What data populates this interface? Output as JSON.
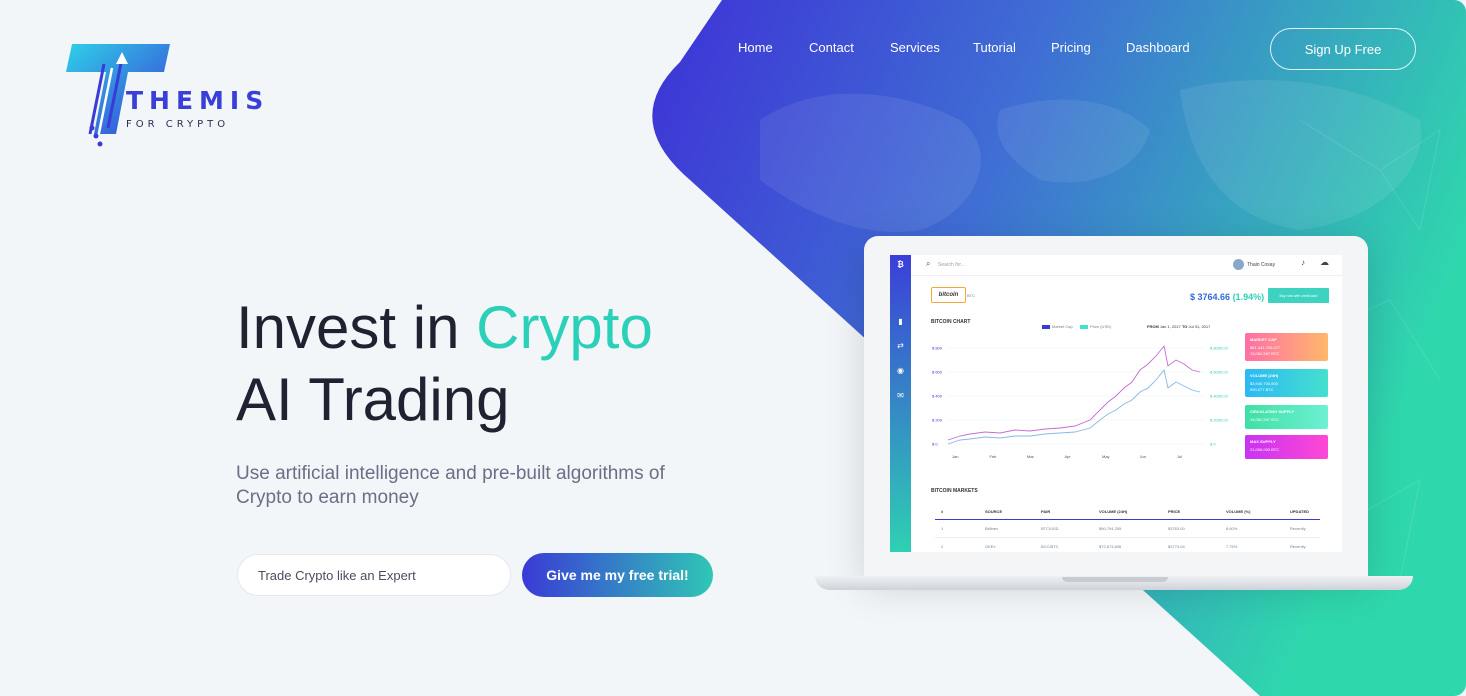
{
  "brand": {
    "name": "THEMIS",
    "tagline": "FOR CRYPTO"
  },
  "nav": {
    "items": [
      "Home",
      "Contact",
      "Services",
      "Tutorial",
      "Pricing",
      "Dashboard"
    ],
    "signup_label": "Sign Up Free"
  },
  "hero": {
    "title_line1_a": "Invest in ",
    "title_line1_b": "Crypto",
    "title_line2": "AI Trading",
    "lead": "Use artificial intelligence and pre-built algorithms of Crypto to earn money",
    "input_value": "Trade Crypto like an Expert",
    "cta_label": "Give me my free trial!"
  },
  "colors": {
    "accent": "#2bd0b8",
    "brand_blue": "#3a3ad6",
    "teal": "#2fd0b3"
  },
  "dashboard": {
    "search_placeholder": "Search for...",
    "user_name": "Thain Cosay",
    "coin_label": "bitcoin",
    "coin_ticker": "BTC",
    "price": "$ 3764.66",
    "change": "(1.94%)",
    "buy_button": "Buy now with credit card",
    "chart_title": "BITCOIN CHART",
    "legend": [
      "Market Cap",
      "Price (USD)"
    ],
    "range_from_label": "FROM",
    "range_from": "Jan 1, 2017",
    "range_to_label": "TO",
    "range_to": "Jul 31, 2017",
    "left_ticks": [
      "$ 800",
      "$ 600",
      "$ 400",
      "$ 200",
      "$ 0"
    ],
    "right_ticks": [
      "$ 8000.00",
      "$ 6000.00",
      "$ 4000.00",
      "$ 2000.00",
      "$ 0"
    ],
    "months": [
      "Jan",
      "Feb",
      "Mar",
      "Apr",
      "May",
      "Jun",
      "Jul"
    ],
    "cards": [
      {
        "title": "MARKET CAP",
        "lines": [
          "$61,441,700,077",
          "13,062,597 BTC"
        ],
        "from": "#ff6fa7",
        "to": "#ffb86b"
      },
      {
        "title": "VOLUME (24H)",
        "lines": [
          "$3,940,700,000",
          "990,077 BTC"
        ],
        "from": "#2bb9f5",
        "to": "#45e0ce"
      },
      {
        "title": "CIRCULATING SUPPLY",
        "lines": [
          "15,062,597 BTC"
        ],
        "from": "#3fe0a4",
        "to": "#6ef0d4"
      },
      {
        "title": "MAX SUPPLY",
        "lines": [
          "21,000,000 BTC"
        ],
        "from": "#c833f3",
        "to": "#ff48d4"
      }
    ],
    "markets_title": "BITCOIN MARKETS",
    "table_headers": [
      "#",
      "SOURCE",
      "PAIR",
      "VOLUME (24H)",
      "PRICE",
      "VOLUME (%)",
      "UPDATED"
    ],
    "table_rows": [
      [
        "1",
        "Bitfinex",
        "BTC/USD",
        "$90,794,255",
        "$3763.00",
        "8.60%",
        "Recently"
      ],
      [
        "2",
        "OKEx",
        "BCC/BTC",
        "$72,673,606",
        "$3773.04",
        "7.75%",
        "Recently"
      ]
    ]
  }
}
